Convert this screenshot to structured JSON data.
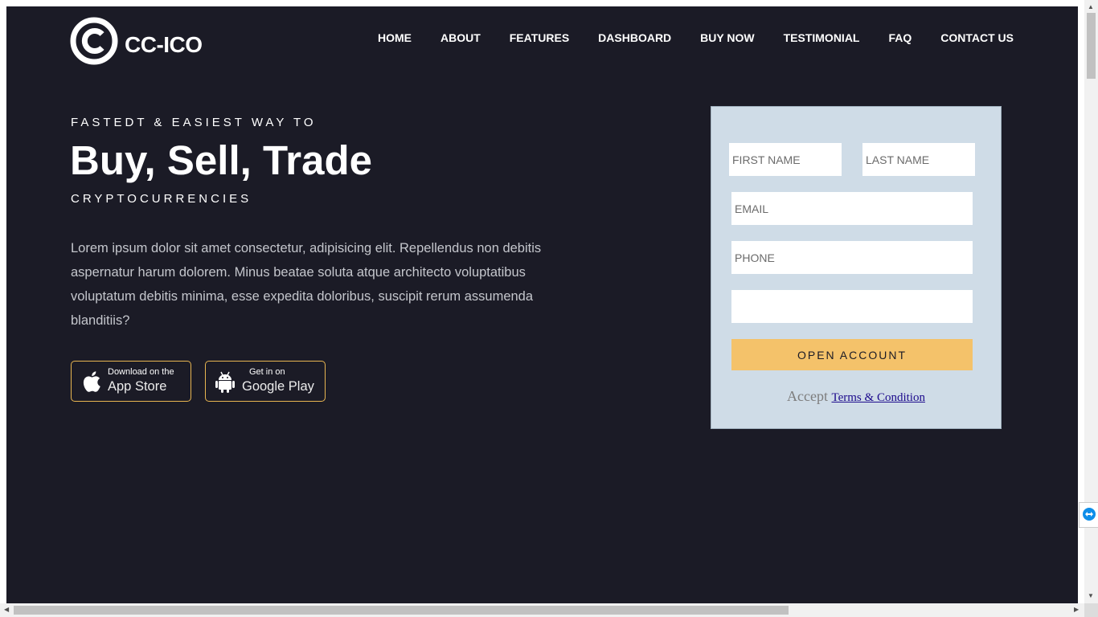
{
  "brand": {
    "name": "CC-ICO",
    "logo_icon": "copyright-icon"
  },
  "nav": {
    "items": [
      "HOME",
      "ABOUT",
      "FEATURES",
      "DASHBOARD",
      "BUY NOW",
      "TESTIMONIAL",
      "FAQ",
      "CONTACT US"
    ]
  },
  "hero": {
    "tagline": "FASTEDT & EASIEST WAY TO",
    "headline": "Buy, Sell, Trade",
    "subline": "CRYPTOCURRENCIES",
    "description": "Lorem ipsum dolor sit amet consectetur, adipisicing elit. Repellendus non debitis aspernatur harum dolorem. Minus beatae soluta atque architecto voluptatibus voluptatum debitis minima, esse expedita doloribus, suscipit rerum assumenda blanditiis?"
  },
  "stores": {
    "appstore": {
      "small": "Download on the",
      "big": "App Store",
      "icon": "apple-icon"
    },
    "googleplay": {
      "small": "Get in on",
      "big": "Google Play",
      "icon": "android-icon"
    }
  },
  "form": {
    "first_name_placeholder": "FIRST NAME",
    "last_name_placeholder": "LAST NAME",
    "email_placeholder": "EMAIL",
    "phone_placeholder": "PHONE",
    "extra_placeholder": "",
    "submit_label": "OPEN ACCOUNT",
    "accept_text": "Accept",
    "terms_link": "Terms & Condition"
  },
  "colors": {
    "page_bg": "#1b1b26",
    "form_bg": "#cfdce7",
    "accent": "#f4c26a",
    "store_border": "#e9b651"
  }
}
